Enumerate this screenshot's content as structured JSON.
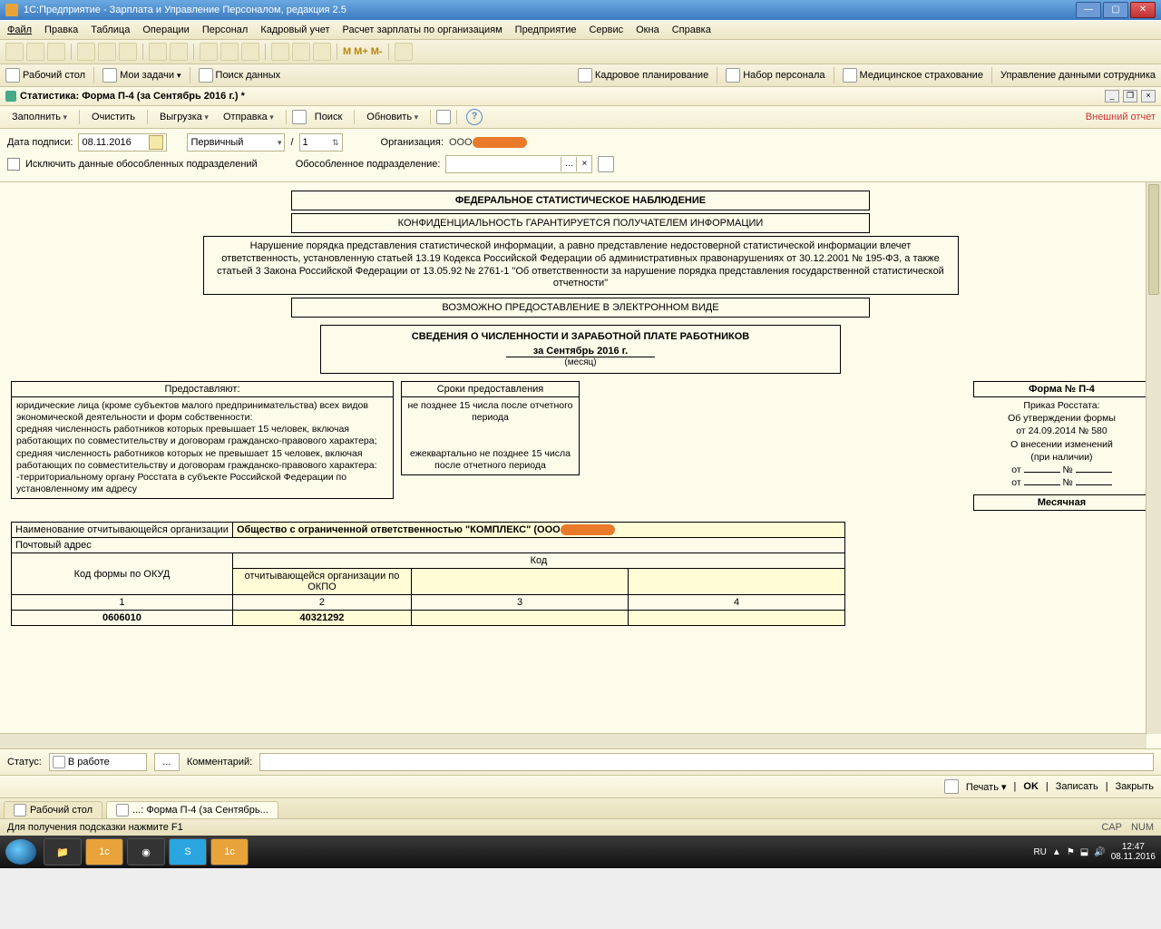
{
  "window": {
    "title": "1С:Предприятие - Зарплата и Управление Персоналом, редакция 2.5"
  },
  "menu": [
    "Файл",
    "Правка",
    "Таблица",
    "Операции",
    "Персонал",
    "Кадровый учет",
    "Расчет зарплаты по организациям",
    "Предприятие",
    "Сервис",
    "Окна",
    "Справка"
  ],
  "nav": {
    "desktop": "Рабочий стол",
    "tasks": "Мои задачи",
    "search": "Поиск данных",
    "kadr": "Кадровое планирование",
    "nabor": "Набор персонала",
    "med": "Медицинское страхование",
    "upr": "Управление данными сотрудника"
  },
  "doc": {
    "title": "Статистика: Форма П-4 (за Сентябрь 2016 г.) *",
    "toolbar": {
      "fill": "Заполнить",
      "clear": "Очистить",
      "export": "Выгрузка",
      "send": "Отправка",
      "find": "Поиск",
      "refresh": "Обновить"
    },
    "ext": "Внешний отчет"
  },
  "params": {
    "date_lbl": "Дата подписи:",
    "date": "08.11.2016",
    "type": "Первичный",
    "slash": "/",
    "num": "1",
    "org_lbl": "Организация:",
    "org_prefix": "ООО",
    "excl": "Исключить данные обособленных подразделений",
    "obos_lbl": "Обособленное подразделение:"
  },
  "report": {
    "h1": "ФЕДЕРАЛЬНОЕ СТАТИСТИЧЕСКОЕ НАБЛЮДЕНИЕ",
    "h2": "КОНФИДЕНЦИАЛЬНОСТЬ ГАРАНТИРУЕТСЯ ПОЛУЧАТЕЛЕМ ИНФОРМАЦИИ",
    "legal": "Нарушение порядка представления статистической информации, а равно представление недостоверной статистической информации влечет ответственность, установленную статьей 13.19 Кодекса Российской Федерации об административных правонарушениях от 30.12.2001 № 195-ФЗ, а также статьей 3 Закона Российской Федерации от 13.05.92 № 2761-1 \"Об ответственности за нарушение порядка представления государственной статистической отчетности\"",
    "h3": "ВОЗМОЖНО ПРЕДОСТАВЛЕНИЕ В ЭЛЕКТРОННОМ ВИДЕ",
    "title": "СВЕДЕНИЯ О ЧИСЛЕННОСТИ И ЗАРАБОТНОЙ ПЛАТЕ РАБОТНИКОВ",
    "period": "за Сентябрь 2016 г.",
    "period_sub": "(месяц)",
    "col1h": "Предоставляют:",
    "col1": "юридические лица (кроме субъектов малого предпринимательства) всех видов экономической деятельности и форм собственности:\n  средняя численность работников которых превышает 15 человек, включая работающих по совместительству и договорам гражданско-правового характера;\n  средняя численность работников которых не превышает 15 человек, включая работающих по совместительству и договорам гражданско-правового характера:\n   -территориальному органу Росстата в субъекте Российской Федерации по установленному им адресу",
    "col2h": "Сроки предоставления",
    "col2a": "не позднее 15 числа после отчетного периода",
    "col2b": "ежеквартально не позднее 15 числа после отчетного периода",
    "formno": "Форма № П-4",
    "prikaz": "Приказ Росстата:\nОб утверждении формы\nот 24.09.2014 № 580\nО внесении изменений\n(при наличии)",
    "ot": "от",
    "no": "№",
    "monthly": "Месячная",
    "org_lbl": "Наименование отчитывающейся организации",
    "org_val": "Общество с ограниченной ответственностью \"КОМПЛЕКС\" (ООО",
    "addr_lbl": "Почтовый адрес",
    "kod": "Код",
    "okud_lbl": "Код формы по ОКУД",
    "okpo_lbl": "отчитывающейся организации по ОКПО",
    "n1": "1",
    "n2": "2",
    "n3": "3",
    "n4": "4",
    "okud": "0606010",
    "okpo": "40321292"
  },
  "status": {
    "lbl": "Статус:",
    "val": "В работе",
    "dots": "...",
    "comm": "Комментарий:"
  },
  "foot": {
    "print": "Печать",
    "ok": "OK",
    "save": "Записать",
    "close": "Закрыть"
  },
  "tabs": {
    "t1": "Рабочий стол",
    "t2": "...: Форма П-4 (за Сентябрь..."
  },
  "hint": {
    "text": "Для получения подсказки нажмите F1",
    "cap": "CAP",
    "num": "NUM"
  },
  "tray": {
    "lang": "RU",
    "time": "12:47",
    "date": "08.11.2016"
  }
}
